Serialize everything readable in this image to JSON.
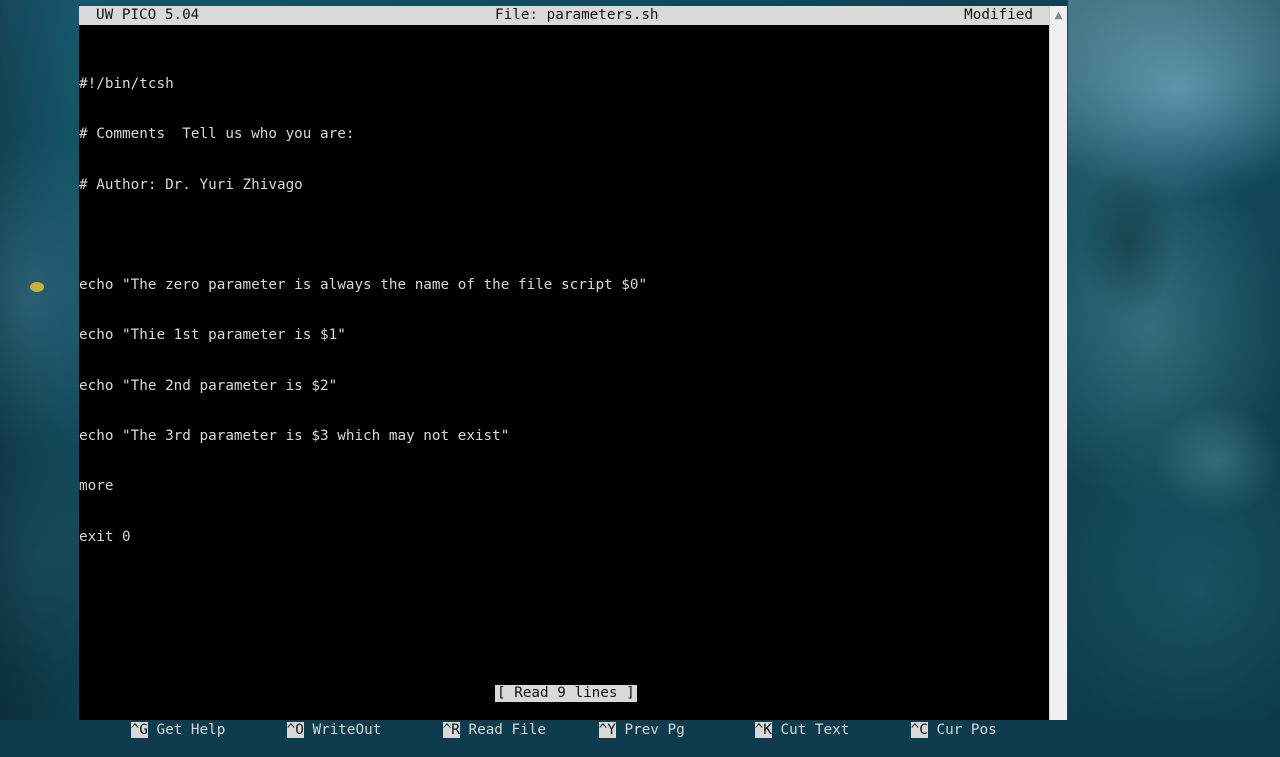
{
  "header": {
    "app": "UW PICO 5.04",
    "file": "File: parameters.sh",
    "status": "Modified"
  },
  "editor": {
    "lines": [
      "#!/bin/tcsh",
      "# Comments  Tell us who you are:",
      "# Author: Dr. Yuri Zhivago",
      "",
      "echo \"The zero parameter is always the name of the file script $0\"",
      "echo \"Thie 1st parameter is $1\"",
      "echo \"The 2nd parameter is $2\"",
      "echo \"The 3rd parameter is $3 which may not exist\"",
      "more",
      "exit 0"
    ]
  },
  "status_message": "[ Read 9 lines ]",
  "shortcuts": [
    {
      "key": "^G",
      "label": "Get Help"
    },
    {
      "key": "^O",
      "label": "WriteOut"
    },
    {
      "key": "^R",
      "label": "Read File"
    },
    {
      "key": "^Y",
      "label": "Prev Pg"
    },
    {
      "key": "^K",
      "label": "Cut Text"
    },
    {
      "key": "^C",
      "label": "Cur Pos"
    }
  ],
  "colors": {
    "terminal_bg": "#000000",
    "terminal_fg": "#d8d8d8",
    "inverse_bg": "#d9d9d9"
  }
}
